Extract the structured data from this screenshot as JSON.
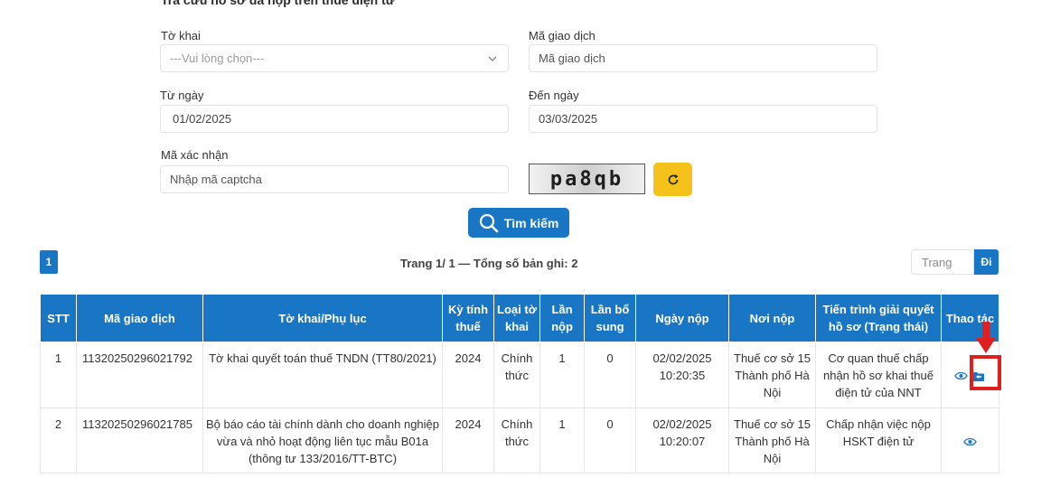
{
  "page": {
    "heading": "Tra cứu hồ sơ đã nộp trên thuế điện tử"
  },
  "form": {
    "to_khai": {
      "label": "Tờ khai",
      "placeholder": "---Vui lòng chọn---"
    },
    "ma_giao_dich": {
      "label": "Mã giao dịch",
      "placeholder": "Mã giao dịch"
    },
    "tu_ngay": {
      "label": "Từ ngày",
      "value": "01/02/2025"
    },
    "den_ngay": {
      "label": "Đến ngày",
      "value": "03/03/2025"
    },
    "ma_xac_nhan": {
      "label": "Mã xác nhận",
      "placeholder": "Nhập mã captcha"
    },
    "captcha_text": "pa8qb",
    "refresh_icon": "refresh-icon",
    "search_button": "Tìm kiếm",
    "search_icon": "search-icon"
  },
  "pagination": {
    "current_page": "1",
    "summary": "Trang 1/ 1 — Tổng số bản ghi: 2",
    "goto_placeholder": "Trang",
    "go_label": "Đi"
  },
  "table": {
    "headers": {
      "stt": "STT",
      "ma": "Mã giao dịch",
      "tokhai": "Tờ khai/Phụ lục",
      "ky": "Kỳ tính thuế",
      "loai": "Loại tờ khai",
      "lannop": "Lần nộp",
      "lanbs": "Lần bổ sung",
      "ngay": "Ngày nộp",
      "noinop": "Nơi nộp",
      "tientrinh": "Tiến trình giải quyết hồ sơ (Trạng thái)",
      "thaotac": "Thao tác"
    },
    "rows": [
      {
        "stt": "1",
        "ma": "11320250296021792",
        "tokhai": "Tờ khai quyết toán thuế TNDN (TT80/2021)",
        "ky": "2024",
        "loai": "Chính thức",
        "lannop": "1",
        "lanbs": "0",
        "ngay": "02/02/2025 10:20:35",
        "noinop": "Thuế cơ sở 15 Thành phố Hà Nội",
        "tientrinh": "Cơ quan thuế chấp nhận hồ sơ khai thuế điện tử của NNT",
        "actions": [
          "eye-icon",
          "folder-open-icon"
        ]
      },
      {
        "stt": "2",
        "ma": "11320250296021785",
        "tokhai": "Bộ báo cáo tài chính dành cho doanh nghiệp vừa và nhỏ hoạt động liên tục mẫu B01a (thông tư 133/2016/TT-BTC)",
        "ky": "2024",
        "loai": "Chính thức",
        "lannop": "1",
        "lanbs": "0",
        "ngay": "02/02/2025 10:20:07",
        "noinop": "Thuế cơ sở 15 Thành phố Hà Nội",
        "tientrinh": "Chấp nhận việc nộp HSKT điện tử",
        "actions": [
          "eye-icon"
        ]
      }
    ]
  },
  "colors": {
    "primary": "#1976c5",
    "captcha_refresh": "#f4c21a",
    "highlight": "#e21f1f"
  }
}
